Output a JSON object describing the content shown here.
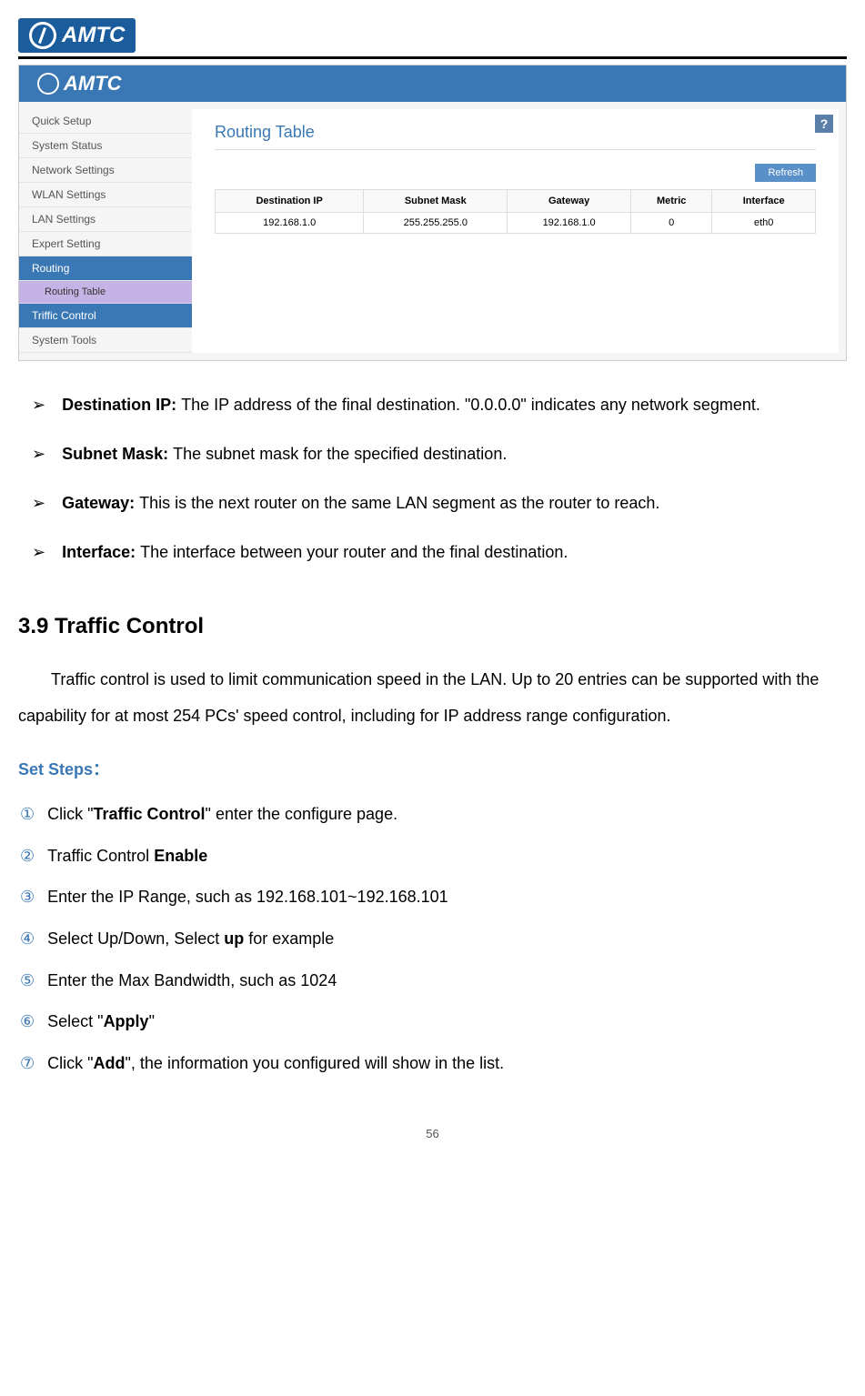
{
  "doc": {
    "logo_text": "AMTC",
    "page_number": "56"
  },
  "screenshot": {
    "logo": "AMTC",
    "help_label": "?",
    "sidebar": {
      "items": [
        {
          "label": "Quick Setup",
          "expanded": false
        },
        {
          "label": "System Status",
          "expanded": false
        },
        {
          "label": "Network Settings",
          "expanded": false
        },
        {
          "label": "WLAN Settings",
          "expanded": false
        },
        {
          "label": "LAN Settings",
          "expanded": false
        },
        {
          "label": "Expert Setting",
          "expanded": false
        },
        {
          "label": "Routing",
          "expanded": true
        },
        {
          "label": "Triffic Control",
          "expanded": false
        },
        {
          "label": "System Tools",
          "expanded": false
        }
      ],
      "subitem": "Routing Table"
    },
    "content": {
      "title": "Routing Table",
      "refresh": "Refresh",
      "headers": [
        "Destination IP",
        "Subnet Mask",
        "Gateway",
        "Metric",
        "Interface"
      ],
      "row": [
        "192.168.1.0",
        "255.255.255.0",
        "192.168.1.0",
        "0",
        "eth0"
      ]
    }
  },
  "bullets": [
    {
      "bold": "Destination IP: ",
      "text": "The IP address of the final destination. \"0.0.0.0\" indicates any network segment."
    },
    {
      "bold": "Subnet Mask: ",
      "text": "The subnet mask for the specified destination."
    },
    {
      "bold": "Gateway: ",
      "text": "This is the next router on the same LAN segment as the router to reach."
    },
    {
      "bold": "Interface: ",
      "text": "The interface between your router and the final destination."
    }
  ],
  "section": {
    "heading": "3.9 Traffic Control",
    "paragraph": "Traffic control is used to limit communication speed in the LAN. Up to 20 entries can be supported with the capability for at most 254 PCs' speed control, including for IP address range configuration.",
    "set_steps_label": "Set Steps：",
    "steps": [
      {
        "num": "①",
        "pre": "Click \"",
        "bold": "Traffic Control",
        "post": "\" enter the configure page."
      },
      {
        "num": "②",
        "pre": "Traffic Control ",
        "bold": "Enable",
        "post": ""
      },
      {
        "num": "③",
        "pre": "Enter the IP Range, such as 192.168.101~192.168.101",
        "bold": "",
        "post": ""
      },
      {
        "num": "④",
        "pre": "Select Up/Down, Select ",
        "bold": "up",
        "post": " for example"
      },
      {
        "num": "⑤",
        "pre": "Enter the Max Bandwidth, such as 1024",
        "bold": "",
        "post": ""
      },
      {
        "num": "⑥",
        "pre": "Select \"",
        "bold": "Apply",
        "post": "\""
      },
      {
        "num": "⑦",
        "pre": "Click \"",
        "bold": "Add",
        "post": "\", the information you configured will show in the list."
      }
    ]
  }
}
